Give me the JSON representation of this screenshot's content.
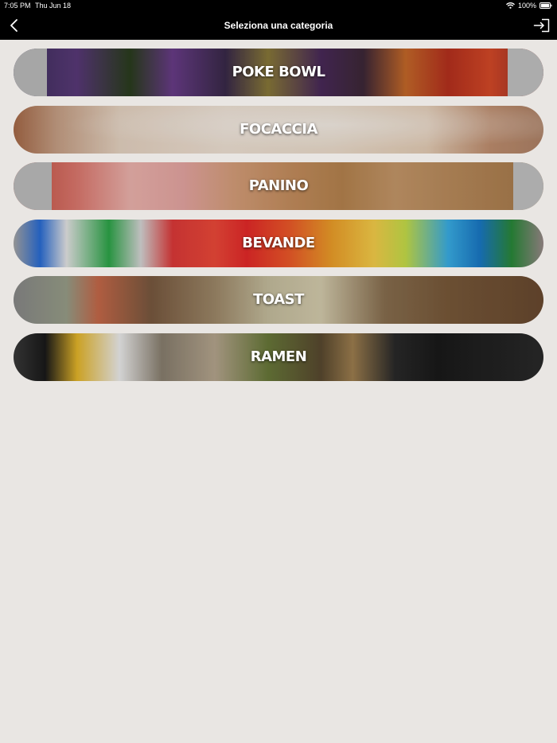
{
  "status_bar": {
    "time": "7:05 PM",
    "date": "Thu Jun 18",
    "battery": "100%"
  },
  "nav": {
    "title": "Seleziona una categoria",
    "back_icon": "chevron-left-icon",
    "login_icon": "login-icon"
  },
  "categories": [
    {
      "label": "POKE BOWL"
    },
    {
      "label": "FOCACCIA"
    },
    {
      "label": "PANINO"
    },
    {
      "label": "BEVANDE"
    },
    {
      "label": "TOAST"
    },
    {
      "label": "RAMEN"
    }
  ],
  "colors": {
    "background": "#e9e6e3",
    "bar": "#000000",
    "text_on_image": "#ffffff"
  }
}
